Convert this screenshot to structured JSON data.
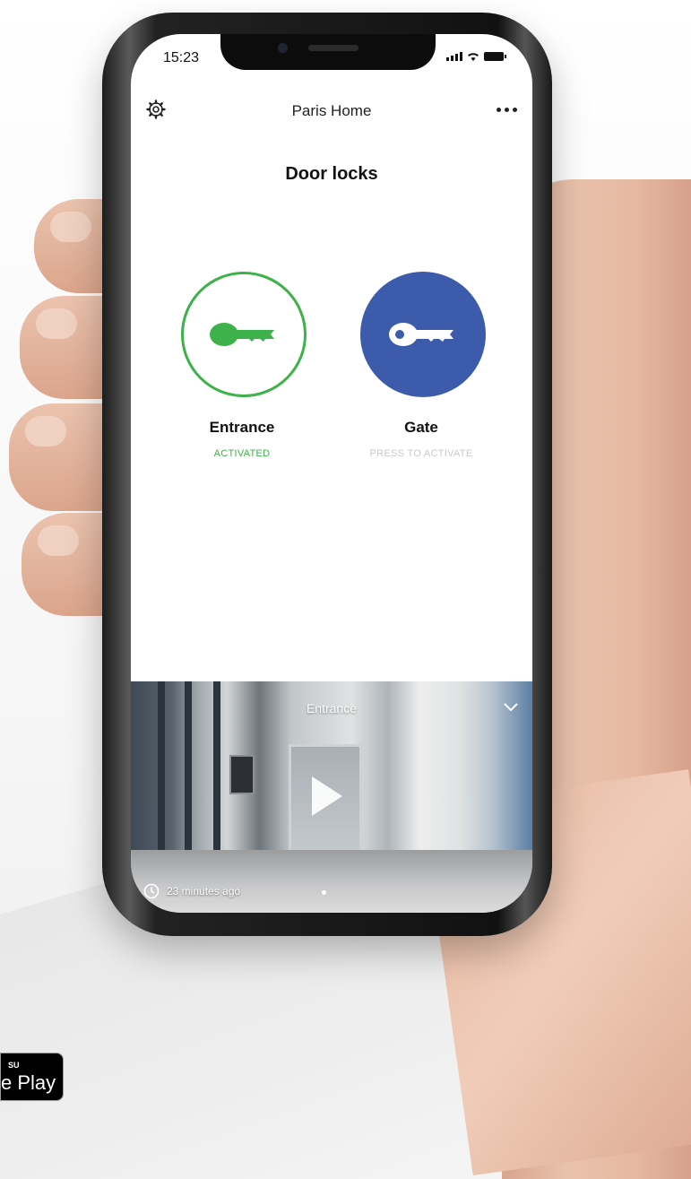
{
  "status_bar": {
    "time": "15:23"
  },
  "header": {
    "title": "Paris Home",
    "settings_icon": "gear-icon",
    "more_icon": "more-dots-icon"
  },
  "section": {
    "title": "Door locks"
  },
  "locks": [
    {
      "name": "Entrance",
      "status": "ACTIVATED",
      "icon": "key-icon",
      "color": "#3eb24a",
      "state": "activated"
    },
    {
      "name": "Gate",
      "status": "PRESS TO ACTIVATE",
      "icon": "key-icon",
      "color": "#3c5bab",
      "state": "inactive"
    }
  ],
  "video": {
    "title": "Entrance",
    "timestamp": "23 minutes ago",
    "play_icon": "play-icon",
    "collapse_icon": "chevron-down-icon",
    "clock_icon": "clock-icon"
  },
  "store_badge": {
    "small": "SU",
    "big": "e Play"
  }
}
